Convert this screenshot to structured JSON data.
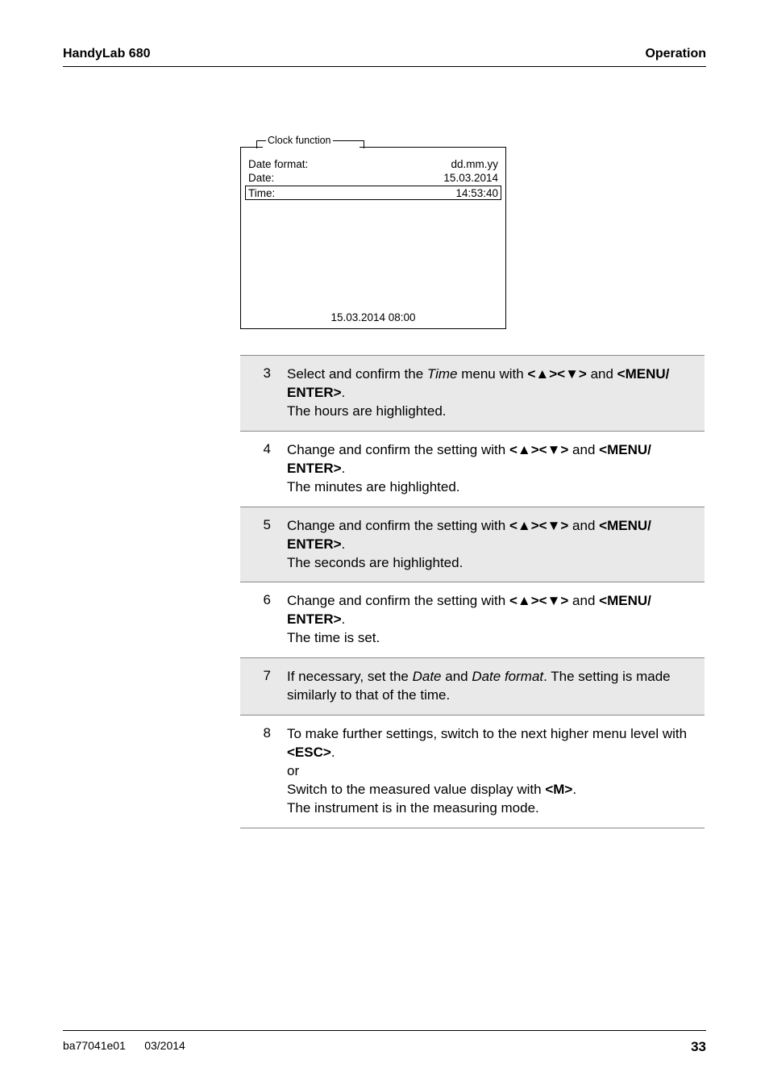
{
  "header": {
    "left": "HandyLab 680",
    "right": "Operation"
  },
  "diagram": {
    "tab_label": "Clock function",
    "rows": [
      {
        "label": "Date format:",
        "value": "dd.mm.yy"
      },
      {
        "label": "Date:",
        "value": "15.03.2014"
      },
      {
        "label": "Time:",
        "value": "14:53:40"
      }
    ],
    "footer_timestamp": "15.03.2014 08:00"
  },
  "steps": [
    {
      "num": "3",
      "shaded": true,
      "html": "Select and confirm the <i>Time</i> menu with <b>&lt;<span class='tri'>▲</span>&gt;&lt;<span class='tri'>▼</span>&gt;</b> and <b>&lt;MENU/<br>ENTER&gt;</b>.<br>The hours are highlighted."
    },
    {
      "num": "4",
      "shaded": false,
      "html": "Change and confirm the setting with <b>&lt;<span class='tri'>▲</span>&gt;&lt;<span class='tri'>▼</span>&gt;</b> and <b>&lt;MENU/<br>ENTER&gt;</b>.<br>The minutes are highlighted."
    },
    {
      "num": "5",
      "shaded": true,
      "html": "Change and confirm the setting with <b>&lt;<span class='tri'>▲</span>&gt;&lt;<span class='tri'>▼</span>&gt;</b> and <b>&lt;MENU/<br>ENTER&gt;</b>.<br>The seconds are highlighted."
    },
    {
      "num": "6",
      "shaded": false,
      "html": "Change and confirm the setting with <b>&lt;<span class='tri'>▲</span>&gt;&lt;<span class='tri'>▼</span>&gt;</b> and <b>&lt;MENU/<br>ENTER&gt;</b>.<br>The time is set."
    },
    {
      "num": "7",
      "shaded": true,
      "html": "If necessary, set the <i>Date</i> and <i>Date format</i>. The setting is made similarly to that of the time."
    },
    {
      "num": "8",
      "shaded": false,
      "html": "To make further settings, switch to the next higher menu level with <b>&lt;ESC&gt;</b>.<br>or<br>Switch to the measured value display with <b>&lt;M&gt;</b>.<br>The instrument is in the measuring mode."
    }
  ],
  "footer": {
    "left1": "ba77041e01",
    "left2": "03/2014",
    "right": "33"
  }
}
